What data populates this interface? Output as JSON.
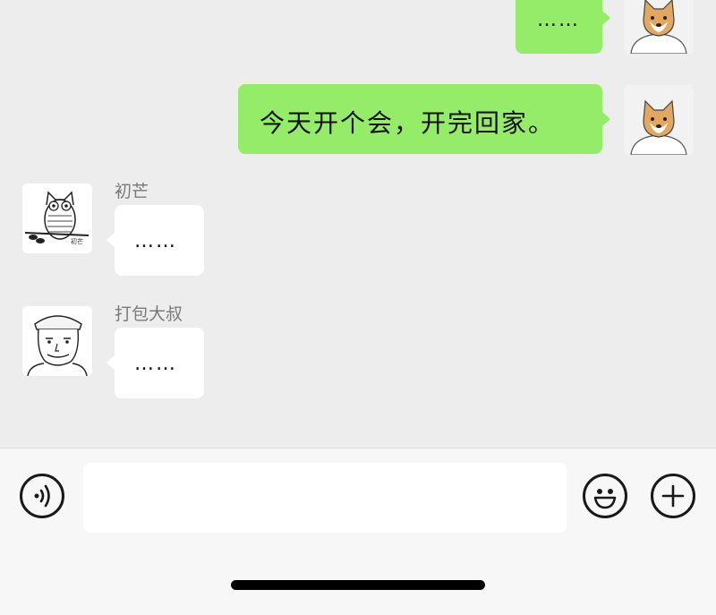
{
  "messages": [
    {
      "side": "me",
      "text": "……"
    },
    {
      "side": "me",
      "text": "今天开个会，开完回家。"
    },
    {
      "side": "other",
      "sender": "初芒",
      "text": "……"
    },
    {
      "side": "other",
      "sender": "打包大叔",
      "text": "……"
    }
  ],
  "avatars": {
    "self": "shiba-dog-avatar",
    "chumang": "owl-sketch-avatar",
    "dabao": "cartoon-man-avatar",
    "owl_caption": "初芒"
  },
  "input_bar": {
    "value": "",
    "voice_icon": "voice-icon",
    "emoji_icon": "emoji-icon",
    "plus_icon": "plus-icon"
  },
  "colors": {
    "my_bubble": "#95ec69",
    "other_bubble": "#ffffff",
    "chat_bg": "#ededed"
  }
}
